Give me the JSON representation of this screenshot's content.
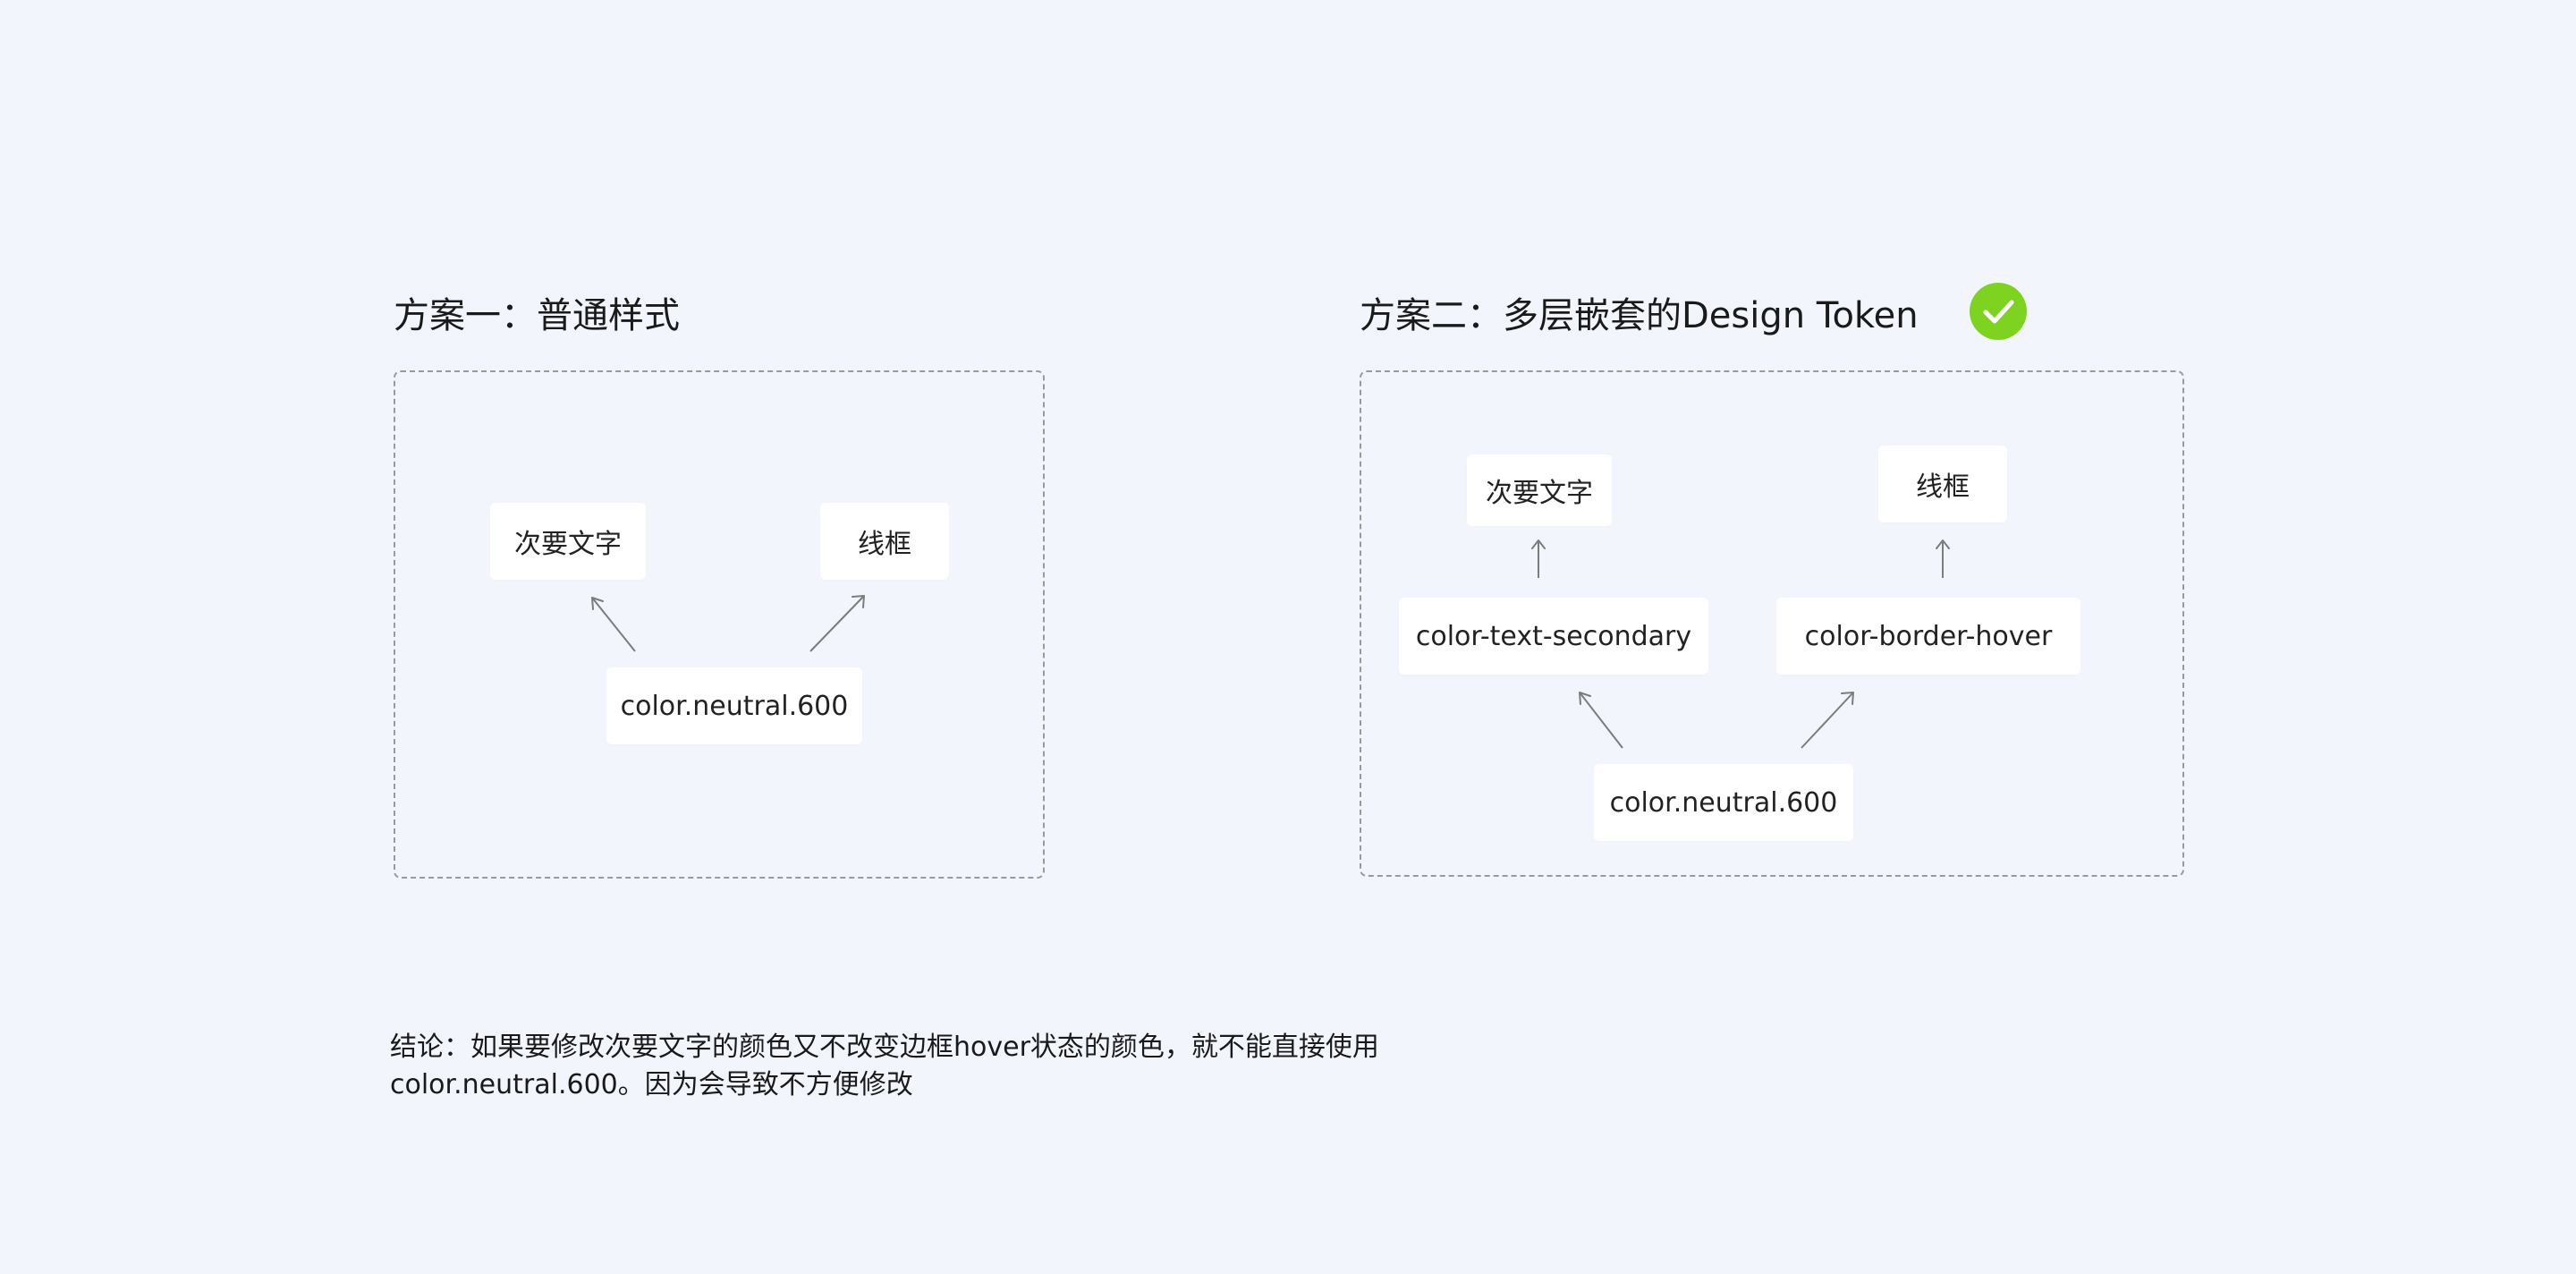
{
  "plan_a": {
    "title": "方案一：普通样式",
    "nodes": {
      "secondary_text": "次要文字",
      "border": "线框",
      "base_token": "color.neutral.600"
    }
  },
  "plan_b": {
    "title": "方案二：多层嵌套的Design Token",
    "badge_icon": "check-circle-icon",
    "badge_color": "#7ed321",
    "nodes": {
      "secondary_text": "次要文字",
      "border": "线框",
      "text_token": "color-text-secondary",
      "border_token": "color-border-hover",
      "base_token": "color.neutral.600"
    }
  },
  "conclusion": {
    "line1": "结论：如果要修改次要文字的颜色又不改变边框hover状态的颜色，就不能直接使用",
    "line2": "color.neutral.600。因为会导致不方便修改"
  }
}
